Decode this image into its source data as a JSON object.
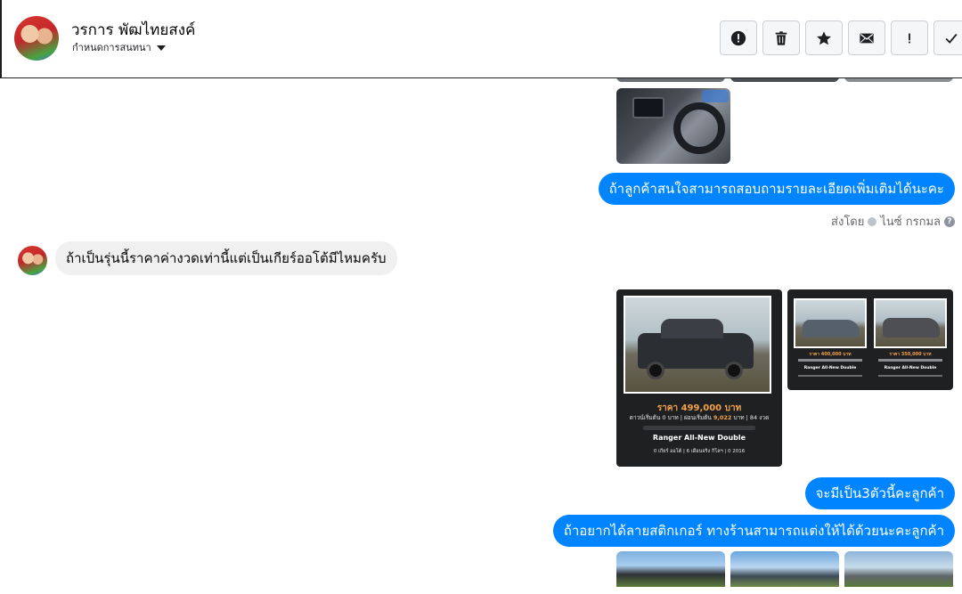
{
  "header": {
    "contact_name": "วรการ พัฒไทยสงค์",
    "subtitle": "กำหนดการสนทนา"
  },
  "toolbar": {
    "buttons": [
      {
        "name": "report",
        "icon": "alert-circle-icon"
      },
      {
        "name": "delete",
        "icon": "trash-icon"
      },
      {
        "name": "star",
        "icon": "star-icon"
      },
      {
        "name": "mark-unread",
        "icon": "envelope-icon"
      },
      {
        "name": "spam",
        "icon": "exclamation-icon"
      },
      {
        "name": "done",
        "icon": "checkmark-icon"
      }
    ]
  },
  "messages": {
    "out_1": "ถ้าลูกค้าสนใจสามารถสอบถามรายละเอียดเพิ่มเติมได้นะคะ",
    "sent_by": "ส่งโดย",
    "sent_by_name": "ไนซ์ กรกมล",
    "in_1": "ถ้าเป็นรุ่นนี้ราคาค่างวดเท่านี้แต่เป็นเกียร์ออโต้มีไหมครับ",
    "out_2": "จะมีเป็น3ตัวนี้คะลูกค้า",
    "out_3": "ถ้าอยากได้ลายสติกเกอร์ ทางร้านสามารถแต่งให้ได้ด้วยนะคะลูกค้า"
  },
  "listing_large": {
    "price": "ราคา 499,000 บาท",
    "down": "ดาวน์เริ่มต้น 0 บาท | ผ่อนเริ่มต้น",
    "installment": "9,022",
    "term": "บาท | 84 งวด",
    "model": "Ranger All-New Double",
    "footer": "0 เกียร์ ออโต้ | 6 เดือนจริง กิโลฯ | 0 2016"
  },
  "listing_small": [
    {
      "price": "ราคา 400,000 บาท",
      "model": "Ranger All-New Double"
    },
    {
      "price": "ราคา 350,000 บาท",
      "model": "Ranger All-New Double"
    }
  ],
  "colors": {
    "accent": "#0084ff",
    "incoming_bubble": "#f0f0f0",
    "card_bg": "#1f2022",
    "price": "#f3a24a"
  }
}
